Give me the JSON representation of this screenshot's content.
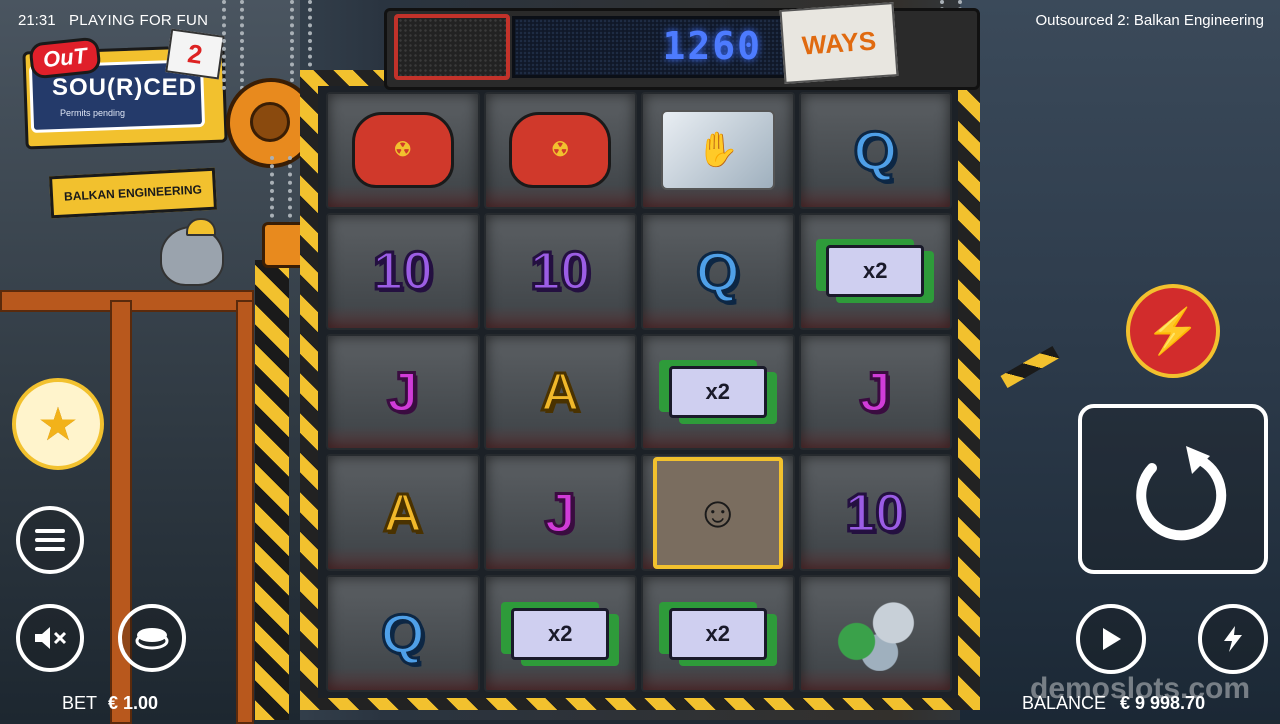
{
  "status_bar": {
    "time": "21:31",
    "mode": "PLAYING FOR FUN",
    "game_title": "Outsourced 2: Balkan Engineering"
  },
  "logo": {
    "out": "OuT",
    "word": "SOU(R)CED",
    "sequel_number": "2",
    "tagline": "Permits pending",
    "sign": "BALKAN ENGINEERING"
  },
  "ways": {
    "value": "1260",
    "label": "WAYS"
  },
  "reels": [
    [
      "gamepad",
      "gamepad",
      "severed-hand-bag",
      "Q"
    ],
    [
      "10",
      "10",
      "Q",
      "x2"
    ],
    [
      "J",
      "A",
      "x2",
      "J"
    ],
    [
      "A",
      "J",
      "engineer-wild",
      "10"
    ],
    [
      "Q",
      "x2",
      "x2",
      "soda-cans"
    ]
  ],
  "controls": {
    "bet_label": "BET",
    "bet_value": "€ 1.00",
    "balance_label": "BALANCE",
    "balance_value": "€ 9 998.70"
  },
  "watermark": "demoslots.com",
  "colors": {
    "hazard_yellow": "#f2c12e",
    "ways_led_blue": "#4d7bff",
    "bolt_red": "#d22c2c"
  }
}
